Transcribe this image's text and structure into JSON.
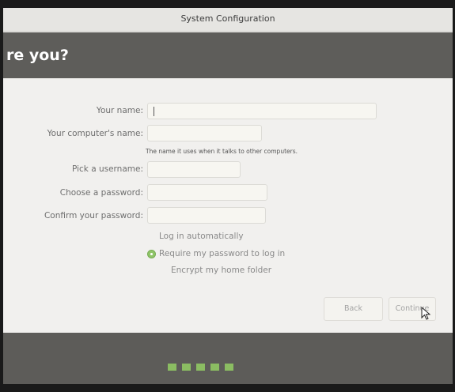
{
  "window": {
    "title": "System Configuration"
  },
  "header": {
    "title": "re you?"
  },
  "form": {
    "your_name": {
      "label": "Your name:",
      "value": ""
    },
    "computer_name": {
      "label": "Your computer's name:",
      "value": "",
      "hint": "The name it uses when it talks to other computers."
    },
    "username": {
      "label": "Pick a username:",
      "value": ""
    },
    "password": {
      "label": "Choose a password:",
      "value": ""
    },
    "confirm_password": {
      "label": "Confirm your password:",
      "value": ""
    }
  },
  "login_options": {
    "auto_login": "Log in automatically",
    "require_password": "Require my password to log in",
    "encrypt_home": "Encrypt my home folder",
    "selected": "require_password"
  },
  "buttons": {
    "back": "Back",
    "continue": "Continue"
  },
  "progress": {
    "steps_total": 5,
    "accent_color": "#8bbd62"
  },
  "icons": {
    "radio_selected": "radio-selected-icon",
    "cursor": "mouse-pointer-icon"
  }
}
